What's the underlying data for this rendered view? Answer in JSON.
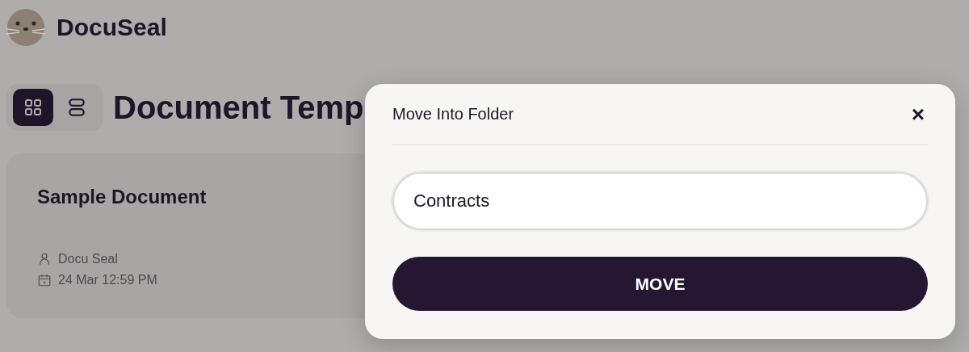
{
  "app": {
    "name": "DocuSeal"
  },
  "view_toggle": [
    {
      "kind": "grid",
      "selected": true
    },
    {
      "kind": "list",
      "selected": false
    }
  ],
  "page_title": "Document Temp",
  "templates": [
    {
      "name": "Sample Document",
      "author": "Docu Seal",
      "date": "24 Mar 12:59 PM"
    }
  ],
  "dialog": {
    "title": "Move Into Folder",
    "close": "×",
    "folder_field": {
      "value": "Contracts"
    },
    "submit": "MOVE"
  }
}
